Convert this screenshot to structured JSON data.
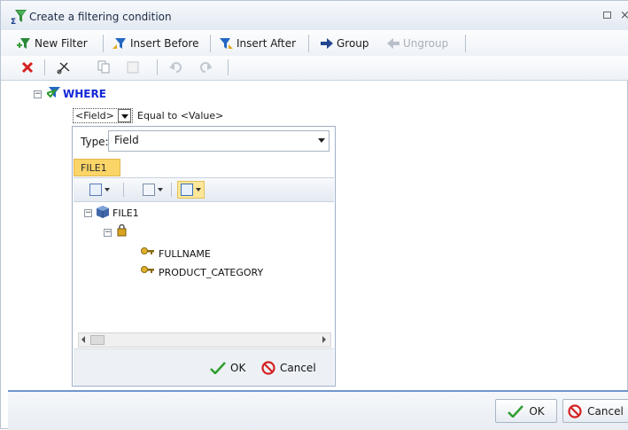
{
  "window": {
    "title": "Create a filtering condition"
  },
  "toolbar": {
    "new_filter": "New Filter",
    "insert_before": "Insert Before",
    "insert_after": "Insert After",
    "group": "Group",
    "ungroup": "Ungroup"
  },
  "edit_toolbar": {
    "icons": [
      "delete-icon",
      "cut-icon",
      "copy-icon",
      "paste-icon",
      "undo-icon",
      "redo-icon"
    ]
  },
  "condition": {
    "where_label": "WHERE",
    "field_placeholder": "<Field>",
    "operator_text": "Equal to <Value>"
  },
  "popup": {
    "type_label": "Type:",
    "type_value": "Field",
    "file_tab": "FILE1",
    "tree": {
      "root": "FILE1",
      "fields": [
        "FULLNAME",
        "PRODUCT_CATEGORY"
      ]
    },
    "ok_label": "OK",
    "cancel_label": "Cancel"
  },
  "dialog": {
    "ok_label": "OK",
    "cancel_label": "Cancel"
  },
  "colors": {
    "where_blue": "#1428d6",
    "tab_yellow": "#fbd567",
    "accent_line": "#6f96cc",
    "delete_red": "#d42020",
    "ok_green": "#2f9e2f"
  }
}
